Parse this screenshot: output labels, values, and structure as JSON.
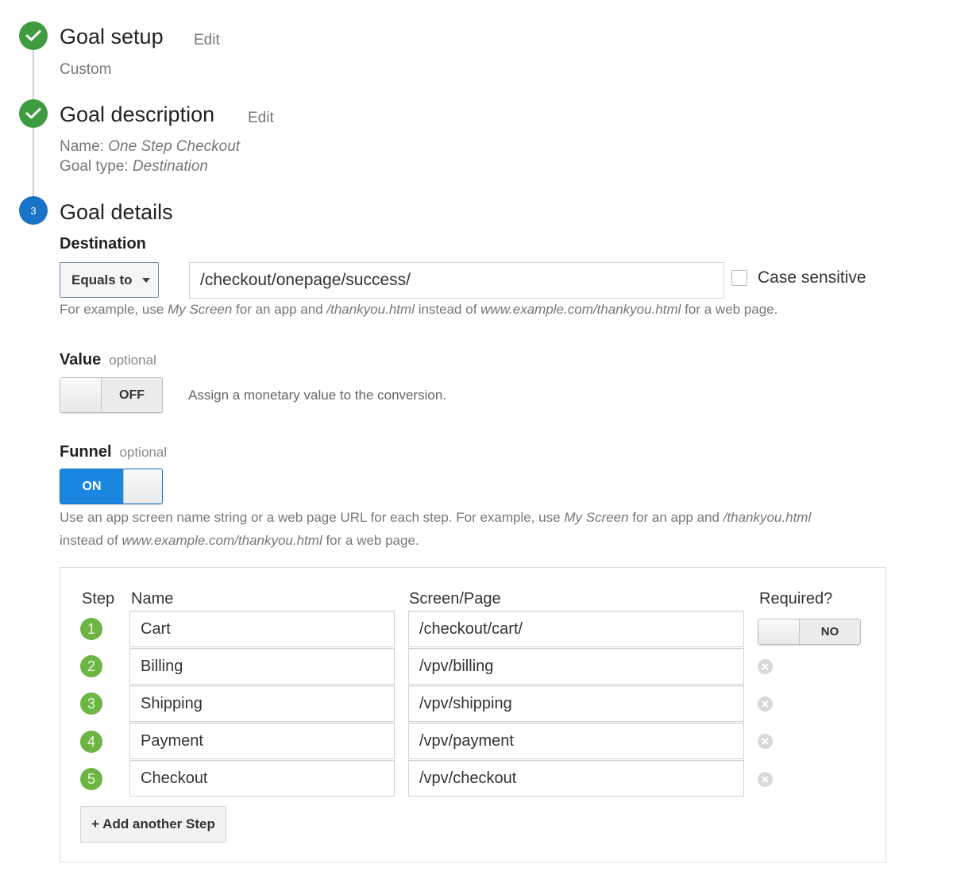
{
  "steps": [
    {
      "number": "1",
      "status": "complete",
      "title": "Goal setup",
      "edit_label": "Edit",
      "summary": "Custom"
    },
    {
      "number": "2",
      "status": "complete",
      "title": "Goal description",
      "edit_label": "Edit",
      "name_label": "Name:",
      "name_value": "One Step Checkout",
      "type_label": "Goal type:",
      "type_value": "Destination"
    },
    {
      "number": "3",
      "status": "current",
      "title": "Goal details"
    }
  ],
  "destination": {
    "label": "Destination",
    "match_type": "Equals to",
    "value": "/checkout/onepage/success/",
    "case_sensitive_label": "Case sensitive",
    "case_sensitive_checked": false,
    "hint": {
      "p1": "For example, use ",
      "i1": "My Screen",
      "p2": " for an app and ",
      "i2": "/thankyou.html",
      "p3": " instead of ",
      "i3": "www.example.com/thankyou.html",
      "p4": " for a web page."
    }
  },
  "value": {
    "label": "Value",
    "optional": "optional",
    "toggle_state": "OFF",
    "description": "Assign a monetary value to the conversion."
  },
  "funnel": {
    "label": "Funnel",
    "optional": "optional",
    "toggle_state": "ON",
    "hint": {
      "p1": "Use an app screen name string or a web page URL for each step. For example, use ",
      "i1": "My Screen",
      "p2": " for an app and ",
      "i2": "/thankyou.html",
      "p3": "instead of ",
      "i3": "www.example.com/thankyou.html",
      "p4": " for a web page."
    },
    "columns": {
      "step": "Step",
      "name": "Name",
      "page": "Screen/Page",
      "required": "Required?"
    },
    "rows": [
      {
        "step": "1",
        "name": "Cart",
        "page": "/checkout/cart/"
      },
      {
        "step": "2",
        "name": "Billing",
        "page": "/vpv/billing"
      },
      {
        "step": "3",
        "name": "Shipping",
        "page": "/vpv/shipping"
      },
      {
        "step": "4",
        "name": "Payment",
        "page": "/vpv/payment"
      },
      {
        "step": "5",
        "name": "Checkout",
        "page": "/vpv/checkout"
      }
    ],
    "required_toggle_state": "NO",
    "add_step_label": "+ Add another Step"
  },
  "colors": {
    "complete": "#3f9b3f",
    "current": "#1a73c8",
    "toggle_on": "#1a86e0",
    "funnel_step": "#6cb543"
  }
}
